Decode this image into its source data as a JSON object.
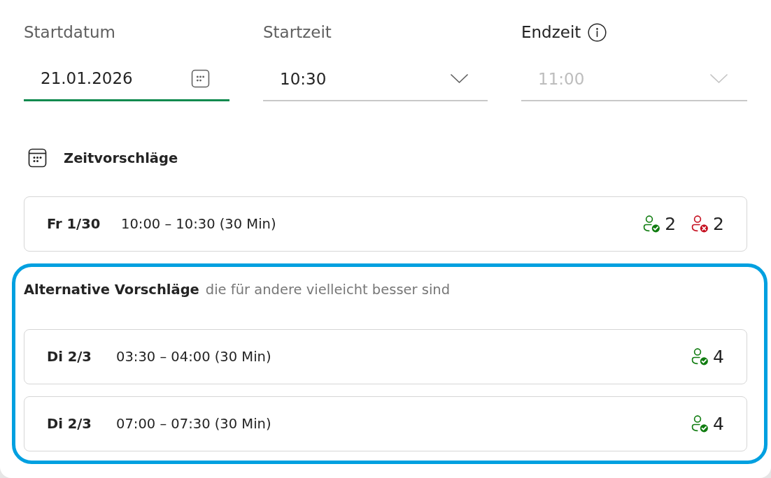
{
  "fields": [
    {
      "kind": "date",
      "label": "Startdatum",
      "value": "21.01.2026",
      "focused": true,
      "disabled": false,
      "info_icon": false
    },
    {
      "kind": "dropdown",
      "label": "Startzeit",
      "value": "10:30",
      "focused": false,
      "disabled": false,
      "info_icon": false
    },
    {
      "kind": "dropdown",
      "label": "Endzeit",
      "value": "11:00",
      "focused": false,
      "disabled": true,
      "info_icon": true
    }
  ],
  "suggestions": {
    "title": "Zeitvorschläge",
    "items": [
      {
        "day": "Fr 1/30",
        "time": "10:00 – 10:30 (30 Min)",
        "attendees": [
          {
            "kind": "accepted",
            "count": "2"
          },
          {
            "kind": "declined",
            "count": "2"
          }
        ]
      }
    ]
  },
  "alternatives": {
    "title": "Alternative Vorschläge",
    "subtitle": "die für andere vielleicht besser sind",
    "highlighted": true,
    "items": [
      {
        "day": "Di 2/3",
        "time": "03:30 – 04:00 (30 Min)",
        "attendees": [
          {
            "kind": "accepted",
            "count": "4"
          }
        ]
      },
      {
        "day": "Di 2/3",
        "time": "07:00 – 07:30 (30 Min)",
        "attendees": [
          {
            "kind": "accepted",
            "count": "4"
          }
        ]
      }
    ]
  }
}
